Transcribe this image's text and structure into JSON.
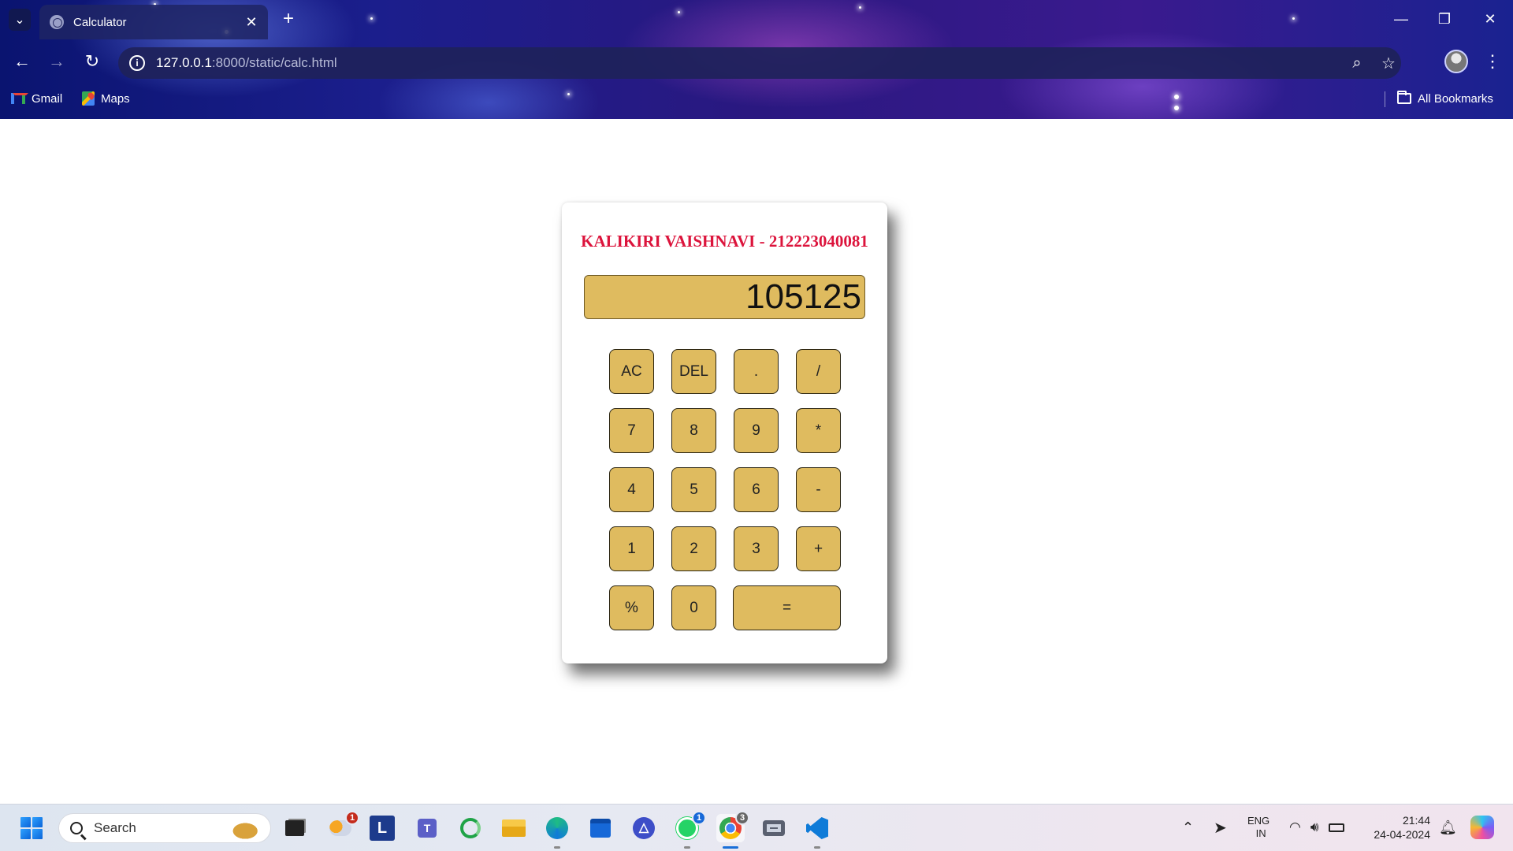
{
  "browser": {
    "tab_title": "Calculator",
    "url_host": "127.0.0.1",
    "url_path": ":8000/static/calc.html",
    "bookmarks": [
      {
        "label": "Gmail",
        "icon": "gmail-icon"
      },
      {
        "label": "Maps",
        "icon": "maps-icon"
      }
    ],
    "all_bookmarks_label": "All Bookmarks"
  },
  "calculator": {
    "heading": "KALIKIRI VAISHNAVI - 212223040081",
    "display_value": "105125",
    "buttons": [
      "AC",
      "DEL",
      ".",
      "/",
      "7",
      "8",
      "9",
      "*",
      "4",
      "5",
      "6",
      "-",
      "1",
      "2",
      "3",
      "+",
      "%",
      "0",
      "="
    ],
    "colors": {
      "button_bg": "#dfbb5f",
      "heading": "#dc143c"
    }
  },
  "taskbar": {
    "search_placeholder": "Search",
    "badges": {
      "weather": "1",
      "whatsapp": "1",
      "chrome": "3"
    },
    "language": "ENG",
    "region": "IN",
    "time": "21:44",
    "date": "24-04-2024"
  }
}
